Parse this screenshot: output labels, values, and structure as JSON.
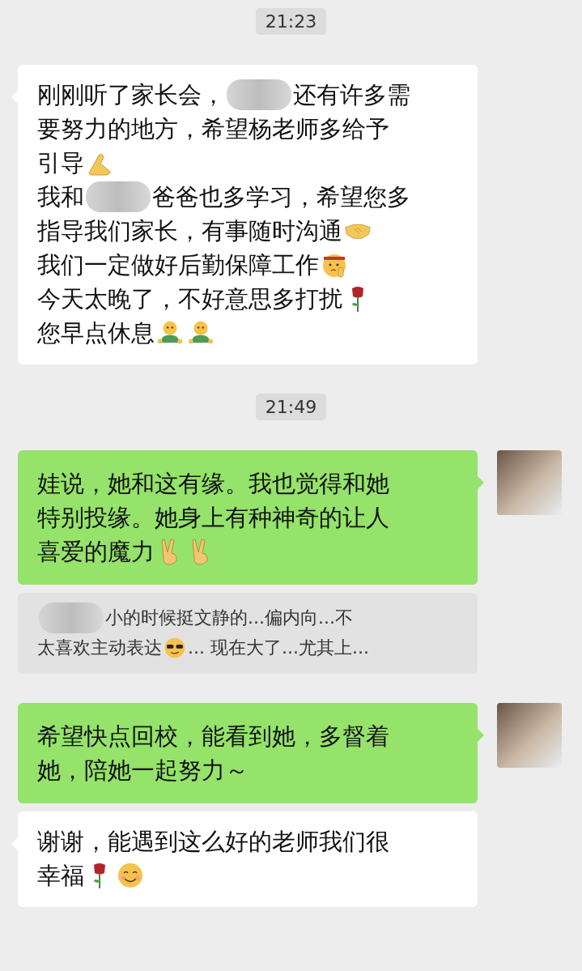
{
  "messages": [
    {
      "kind": "time",
      "text": "21:23"
    },
    {
      "kind": "received",
      "lines": [
        [
          {
            "kind": "text",
            "text": "刚刚听了家长会，"
          },
          {
            "kind": "redacted"
          },
          {
            "kind": "text",
            "text": "还有许多需"
          }
        ],
        [
          {
            "kind": "text",
            "text": "要努力的地方，希望杨老师多给予"
          }
        ],
        [
          {
            "kind": "text",
            "text": "引导"
          },
          {
            "kind": "okhand"
          }
        ],
        [
          {
            "kind": "text",
            "text": "我和"
          },
          {
            "kind": "redacted"
          },
          {
            "kind": "text",
            "text": "爸爸也多学习，希望您多"
          }
        ],
        [
          {
            "kind": "text",
            "text": "指导我们家长，有事随时沟通"
          },
          {
            "kind": "handshake"
          }
        ],
        [
          {
            "kind": "text",
            "text": "我们一定做好后勤保障工作"
          },
          {
            "kind": "salute"
          }
        ],
        [
          {
            "kind": "text",
            "text": "今天太晚了，不好意思多打扰"
          },
          {
            "kind": "rose"
          }
        ],
        [
          {
            "kind": "text",
            "text": "您早点休息"
          },
          {
            "kind": "hug"
          },
          {
            "kind": "hug"
          }
        ]
      ]
    },
    {
      "kind": "time",
      "text": "21:49"
    },
    {
      "kind": "sent",
      "lines": [
        [
          {
            "kind": "text",
            "text": "娃说，她和这有缘。我也觉得和她"
          }
        ],
        [
          {
            "kind": "text",
            "text": "特别投缘。她身上有种神奇的让人"
          }
        ],
        [
          {
            "kind": "text",
            "text": "喜爱的魔力"
          },
          {
            "kind": "victory"
          },
          {
            "kind": "victory"
          }
        ]
      ]
    },
    {
      "kind": "quote",
      "lines": [
        [
          {
            "kind": "redacted"
          },
          {
            "kind": "text",
            "text": "小的时候挺文静的...偏内向...不"
          }
        ],
        [
          {
            "kind": "text",
            "text": "太喜欢主动表达"
          },
          {
            "kind": "sunglasses"
          },
          {
            "kind": "text",
            "text": "...  现在大了...尤其上..."
          }
        ]
      ]
    },
    {
      "kind": "sent",
      "lines": [
        [
          {
            "kind": "text",
            "text": "希望快点回校，能看到她，多督着"
          }
        ],
        [
          {
            "kind": "text",
            "text": "她，陪她一起努力～"
          }
        ]
      ]
    },
    {
      "kind": "received",
      "lines": [
        [
          {
            "kind": "text",
            "text": "谢谢，能遇到这么好的老师我们很"
          }
        ],
        [
          {
            "kind": "text",
            "text": "幸福"
          },
          {
            "kind": "rose"
          },
          {
            "kind": "smile"
          }
        ]
      ]
    }
  ]
}
